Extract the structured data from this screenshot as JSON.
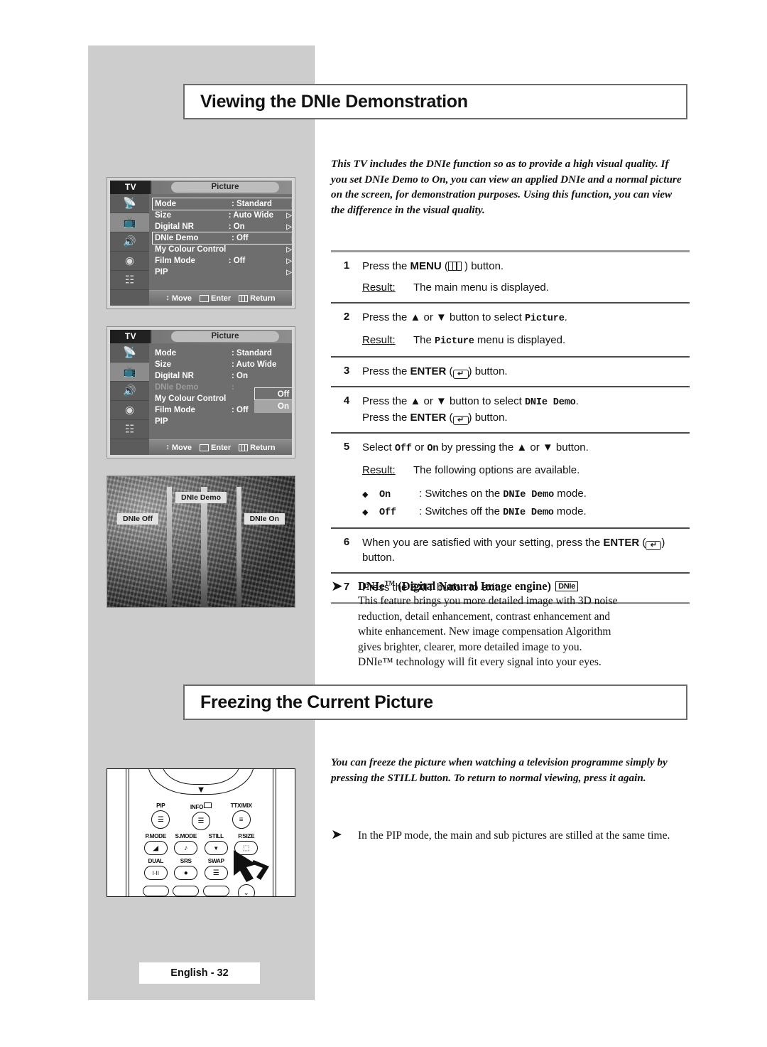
{
  "page": {
    "footer_label": "English - 32"
  },
  "sections": [
    {
      "title": "Viewing the DNIe Demonstration",
      "intro": "This TV includes the DNIe function so as to provide a high visual quality. If you set DNIe Demo to On, you can view an applied DNIe and a normal picture on the screen, for demonstration purposes. Using this function, you can view the difference in the visual quality."
    },
    {
      "title": "Freezing the Current Picture",
      "intro": "You can freeze the picture when watching a television programme simply by pressing the STILL button. To return to normal viewing, press it again.",
      "bullet": "In the PIP mode, the main and sub pictures are stilled at the same time."
    }
  ],
  "steps": {
    "s1": {
      "num": "1",
      "pre": "Press the ",
      "bold": "MENU",
      "icon": "menu-icon",
      "post": " ) button.",
      "open": " ("
    },
    "s1r": {
      "label": "Result:",
      "text": "The main menu is displayed."
    },
    "s2": {
      "num": "2",
      "pre": "Press the ▲ or ▼ button to select ",
      "mono": "Picture",
      "post": "."
    },
    "s2r": {
      "label": "Result:",
      "pre": "The ",
      "mono": "Picture",
      "post": " menu is displayed."
    },
    "s3": {
      "num": "3",
      "pre": "Press the ",
      "bold": "ENTER",
      "open": " (",
      "icon": "enter-icon",
      "post": ") button."
    },
    "s4": {
      "num": "4",
      "line1_pre": "Press the ▲ or ▼ button to select ",
      "line1_mono": "DNIe Demo",
      "line1_post": ".",
      "line2_pre": "Press the ",
      "line2_bold": "ENTER",
      "line2_open": " (",
      "line2_post": ") button."
    },
    "s5": {
      "num": "5",
      "pre": "Select ",
      "mono_off": "Off",
      "mid": " or ",
      "mono_on": "On",
      "post": " by pressing the ▲ or ▼ button.",
      "result_label": "Result:",
      "result_text": "The following options are available.",
      "options": [
        {
          "key": "On",
          "pre": ": Switches on the ",
          "mono": "DNIe Demo",
          "post": " mode."
        },
        {
          "key": "Off",
          "pre": ": Switches off the ",
          "mono": "DNIe Demo",
          "post": " mode."
        }
      ]
    },
    "s6": {
      "num": "6",
      "pre": "When you are satisfied with your setting, press the ",
      "bold": "ENTER",
      "open": " (",
      "post": ")",
      "line2": "button."
    },
    "s7": {
      "num": "7",
      "pre": "Press the ",
      "bold": "EXIT",
      "post": " button to exit."
    }
  },
  "note": {
    "title_main": "DNIe",
    "title_sup": "TM",
    "title_rest": " (Digital Natural Image engine)",
    "badge": "DNIe",
    "body_line1": "This feature brings you more detailed image with 3D noise",
    "body_line2": "reduction, detail enhancement, contrast enhancement and",
    "body_line3": "white enhancement. New image compensation Algorithm",
    "body_line4": "gives brighter, clearer, more detailed image to you.",
    "body_line5": "DNIe™ technology will fit every signal into your eyes."
  },
  "osd": {
    "tv_label": "TV",
    "tab_label": "Picture",
    "icons": [
      "antenna-icon",
      "tv-icon",
      "speaker-icon",
      "setup-icon",
      "special-icon"
    ],
    "bottom": {
      "move": "Move",
      "enter": "Enter",
      "return": "Return"
    },
    "menu1_rows": [
      {
        "label": "Mode",
        "value": ": Standard",
        "arrow": true,
        "boxed": false,
        "dim": false
      },
      {
        "label": "Size",
        "value": ": Auto Wide",
        "arrow": true,
        "boxed": false,
        "dim": false
      },
      {
        "label": "Digital NR",
        "value": ": On",
        "arrow": true,
        "boxed": false,
        "dim": false
      },
      {
        "label": "DNIe Demo",
        "value": ": Off",
        "arrow": true,
        "boxed": true,
        "dim": false
      },
      {
        "label": "My Colour Control",
        "value": "",
        "arrow": true,
        "boxed": false,
        "dim": false
      },
      {
        "label": "Film Mode",
        "value": ": Off",
        "arrow": true,
        "boxed": false,
        "dim": false
      },
      {
        "label": "PIP",
        "value": "",
        "arrow": true,
        "boxed": false,
        "dim": false
      }
    ],
    "menu2_rows": [
      {
        "label": "Mode",
        "value": ": Standard",
        "arrow": false,
        "boxed": false,
        "dim": false
      },
      {
        "label": "Size",
        "value": ": Auto Wide",
        "arrow": false,
        "boxed": false,
        "dim": false
      },
      {
        "label": "Digital NR",
        "value": ": On",
        "arrow": false,
        "boxed": false,
        "dim": false
      },
      {
        "label": "DNIe Demo",
        "value": ":",
        "arrow": false,
        "boxed": false,
        "dim": true
      },
      {
        "label": "My Colour Control",
        "value": "",
        "arrow": false,
        "boxed": false,
        "dim": false
      },
      {
        "label": "Film Mode",
        "value": ": Off",
        "arrow": false,
        "boxed": false,
        "dim": false
      },
      {
        "label": "PIP",
        "value": "",
        "arrow": false,
        "boxed": false,
        "dim": false
      }
    ],
    "dropdown": {
      "selected": "Off",
      "other": "On"
    }
  },
  "photo": {
    "center_label": "DNIe Demo",
    "left_label": "DNIe Off",
    "right_label": "DNIe On"
  },
  "remote": {
    "row1": [
      {
        "label": "PIP",
        "glyph": "☰"
      },
      {
        "label": "INFO",
        "glyph": "☰"
      },
      {
        "label": "TTX/MIX",
        "glyph": "≡"
      }
    ],
    "row2": [
      {
        "label": "P.MODE",
        "glyph": "◢"
      },
      {
        "label": "S.MODE",
        "glyph": "♪"
      },
      {
        "label": "STILL",
        "glyph": "▼"
      },
      {
        "label": "P.SIZE",
        "glyph": "⬚"
      }
    ],
    "row3": [
      {
        "label": "DUAL",
        "glyph": "I·II"
      },
      {
        "label": "SRS",
        "glyph": "●"
      },
      {
        "label": "SWAP",
        "glyph": "☰"
      }
    ],
    "row4_last_glyph": "⌄"
  },
  "colors": {
    "page_grey": "#cdcdcd",
    "osd_bg": "#6e6e6e",
    "osd_sidebar": "#5c5c5c",
    "rule": "#4a4a4a"
  }
}
